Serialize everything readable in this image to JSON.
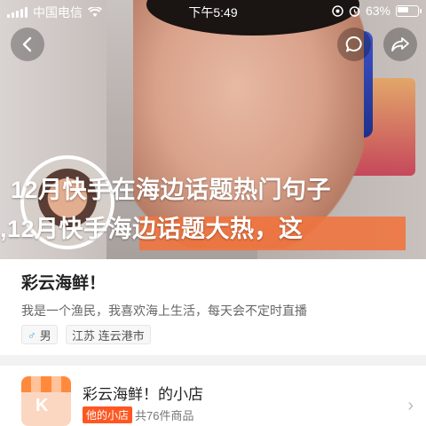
{
  "status_bar": {
    "carrier": "中国电信",
    "time": "下午5:49",
    "battery": "63%",
    "battery_level": 0.63
  },
  "header": {
    "back_icon": "chevron-left-icon",
    "comment_icon": "comment-bubble-icon",
    "share_icon": "share-arrow-icon"
  },
  "overlay": {
    "line1": "12月快手在海边话题热门句子",
    "line2": ",12月快手海边话题大热，这"
  },
  "profile": {
    "name": "彩云海鲜！",
    "bio": "我是一个渔民，我喜欢海上生活，每天会不定时直播",
    "gender": "男",
    "location": "江苏 连云港市"
  },
  "shop": {
    "name": "彩云海鲜！的小店",
    "badge": "他的小店",
    "count": "共76件商品",
    "logo_letter": "K"
  },
  "colors": {
    "accent": "#ff5722",
    "overlay_bar": "#f0743f"
  }
}
